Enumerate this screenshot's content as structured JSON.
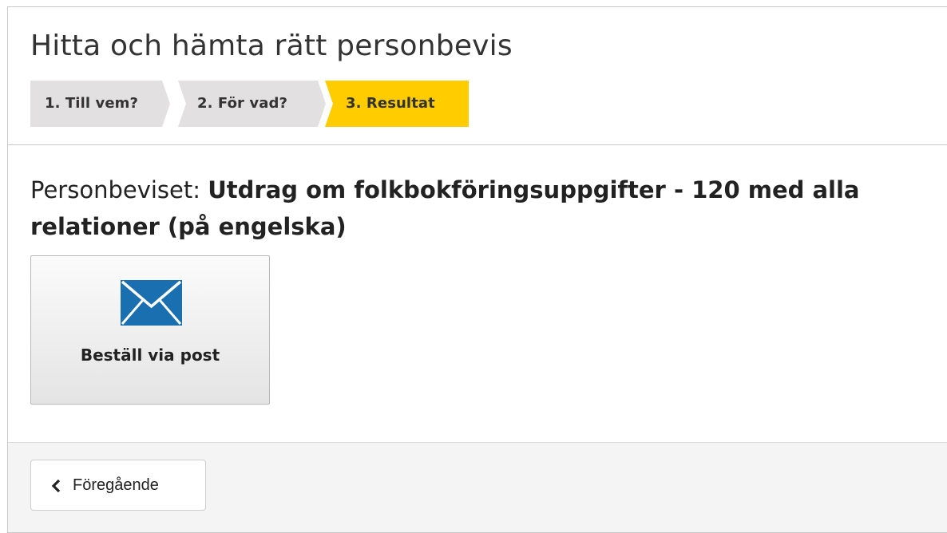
{
  "header": {
    "title": "Hitta och hämta rätt personbevis"
  },
  "steps": [
    {
      "label": "1. Till vem?",
      "state": "done"
    },
    {
      "label": "2. För vad?",
      "state": "done"
    },
    {
      "label": "3. Resultat",
      "state": "active"
    }
  ],
  "colors": {
    "step_inactive": "#e2e0e0",
    "step_active": "#ffcc00",
    "envelope": "#1a6fb0"
  },
  "result": {
    "lead": "Personbeviset:",
    "name": "Utdrag om folkbokföringsuppgifter - 120 med alla relationer (på engelska)"
  },
  "actions": {
    "post_label": "Beställ via post",
    "post_icon": "envelope-icon"
  },
  "footer": {
    "prev_label": "Föregående",
    "prev_icon": "chevron-left-icon"
  }
}
